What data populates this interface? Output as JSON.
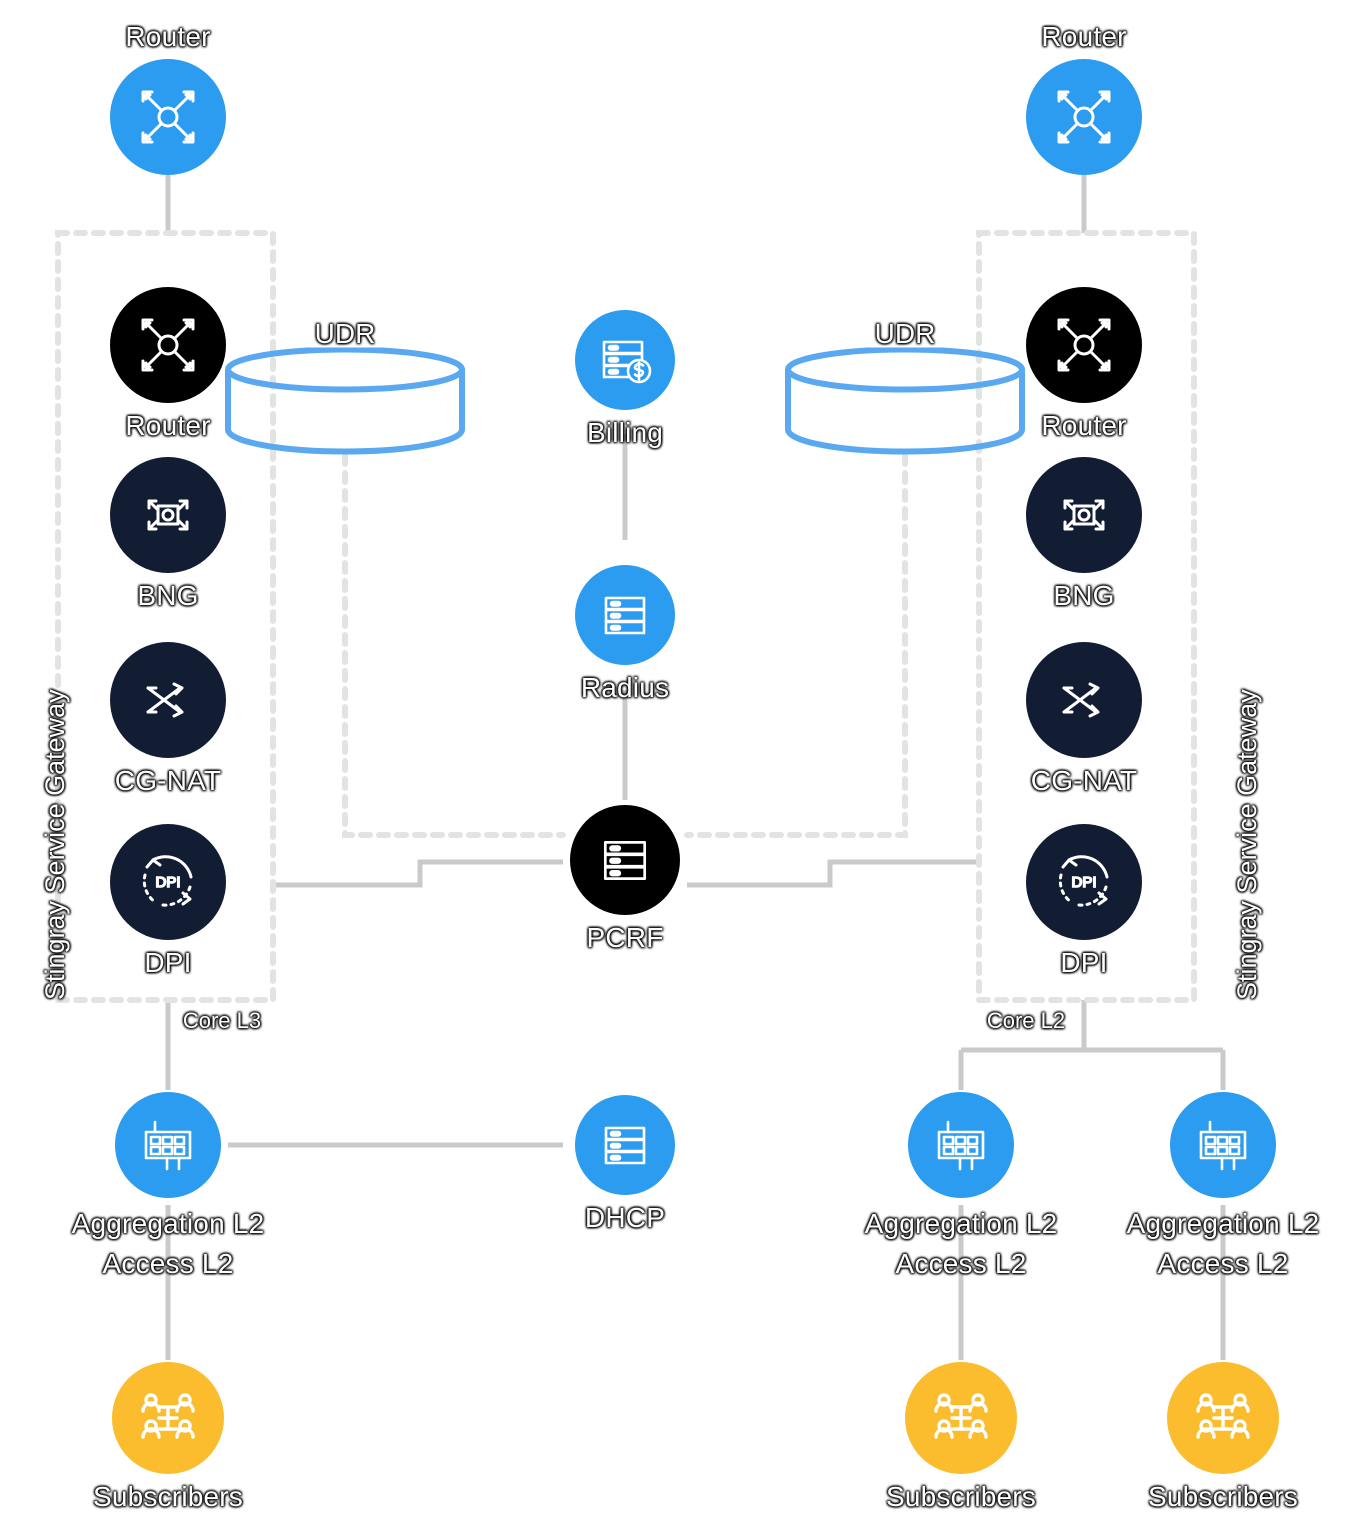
{
  "diagram": {
    "title": "Stingray Service Gateway network topology",
    "colors": {
      "blue": "#2b9cf0",
      "dark_navy": "#121c33",
      "black": "#000000",
      "amber": "#fbbc2e",
      "wire": "#c9cbc9",
      "dashed": "#e2e4e2",
      "cylinder_stroke": "#5aa9f0",
      "label_text": "#ffffff"
    }
  },
  "groups": [
    {
      "id": "gw-left",
      "label": "Stingray Service Gateway",
      "core_label": "Core L3"
    },
    {
      "id": "gw-right",
      "label": "Stingray Service Gateway",
      "core_label": "Core L2"
    }
  ],
  "nodes": [
    {
      "id": "router-top-left",
      "label": "Router",
      "icon": "router-icon",
      "style": "blue",
      "label_pos": "above"
    },
    {
      "id": "router-top-right",
      "label": "Router",
      "icon": "router-icon",
      "style": "blue",
      "label_pos": "above"
    },
    {
      "id": "router-left",
      "label": "Router",
      "icon": "router-icon",
      "style": "black",
      "label_pos": "below"
    },
    {
      "id": "bng-left",
      "label": "BNG",
      "icon": "bng-icon",
      "style": "navy",
      "label_pos": "below"
    },
    {
      "id": "cgnat-left",
      "label": "CG-NAT",
      "icon": "cgnat-icon",
      "style": "navy",
      "label_pos": "below"
    },
    {
      "id": "dpi-left",
      "label": "DPI",
      "icon": "dpi-icon",
      "style": "navy",
      "label_pos": "below"
    },
    {
      "id": "router-right",
      "label": "Router",
      "icon": "router-icon",
      "style": "black",
      "label_pos": "below"
    },
    {
      "id": "bng-right",
      "label": "BNG",
      "icon": "bng-icon",
      "style": "navy",
      "label_pos": "below"
    },
    {
      "id": "cgnat-right",
      "label": "CG-NAT",
      "icon": "cgnat-icon",
      "style": "navy",
      "label_pos": "below"
    },
    {
      "id": "dpi-right",
      "label": "DPI",
      "icon": "dpi-icon",
      "style": "navy",
      "label_pos": "below"
    },
    {
      "id": "udr-left",
      "label": "UDR",
      "icon": "database-icon",
      "style": "cylinder",
      "label_pos": "above"
    },
    {
      "id": "udr-right",
      "label": "UDR",
      "icon": "database-icon",
      "style": "cylinder",
      "label_pos": "above"
    },
    {
      "id": "billing",
      "label": "Billing",
      "icon": "billing-server-icon",
      "style": "blue",
      "label_pos": "below"
    },
    {
      "id": "radius",
      "label": "Radius",
      "icon": "server-icon",
      "style": "blue",
      "label_pos": "below"
    },
    {
      "id": "pcrf",
      "label": "PCRF",
      "icon": "server-rack-icon",
      "style": "black",
      "label_pos": "below"
    },
    {
      "id": "dhcp",
      "label": "DHCP",
      "icon": "server-icon",
      "style": "blue",
      "label_pos": "below"
    },
    {
      "id": "agg-left",
      "label": "Aggregation L2\nAccess L2",
      "icon": "switch-icon",
      "style": "blue",
      "label_pos": "below"
    },
    {
      "id": "agg-right-1",
      "label": "Aggregation L2\nAccess L2",
      "icon": "switch-icon",
      "style": "blue",
      "label_pos": "below"
    },
    {
      "id": "agg-right-2",
      "label": "Aggregation L2\nAccess L2",
      "icon": "switch-icon",
      "style": "blue",
      "label_pos": "below"
    },
    {
      "id": "subs-left",
      "label": "Subscribers",
      "icon": "subscribers-icon",
      "style": "amber",
      "label_pos": "below"
    },
    {
      "id": "subs-right-1",
      "label": "Subscribers",
      "icon": "subscribers-icon",
      "style": "amber",
      "label_pos": "below"
    },
    {
      "id": "subs-right-2",
      "label": "Subscribers",
      "icon": "subscribers-icon",
      "style": "amber",
      "label_pos": "below"
    }
  ],
  "labels": {
    "router_top_left": "Router",
    "router_top_right": "Router",
    "router_left": "Router",
    "bng_left": "BNG",
    "cgnat_left": "CG-NAT",
    "dpi_left": "DPI",
    "router_right": "Router",
    "bng_right": "BNG",
    "cgnat_right": "CG-NAT",
    "dpi_right": "DPI",
    "udr_left": "UDR",
    "udr_right": "UDR",
    "billing": "Billing",
    "radius": "Radius",
    "pcrf": "PCRF",
    "dhcp": "DHCP",
    "agg_line1": "Aggregation L2",
    "agg_line2": "Access L2",
    "subscribers": "Subscribers",
    "gateway_left": "Stingray Service Gateway",
    "gateway_right": "Stingray Service Gateway",
    "core_left": "Core L3",
    "core_right": "Core L2"
  }
}
